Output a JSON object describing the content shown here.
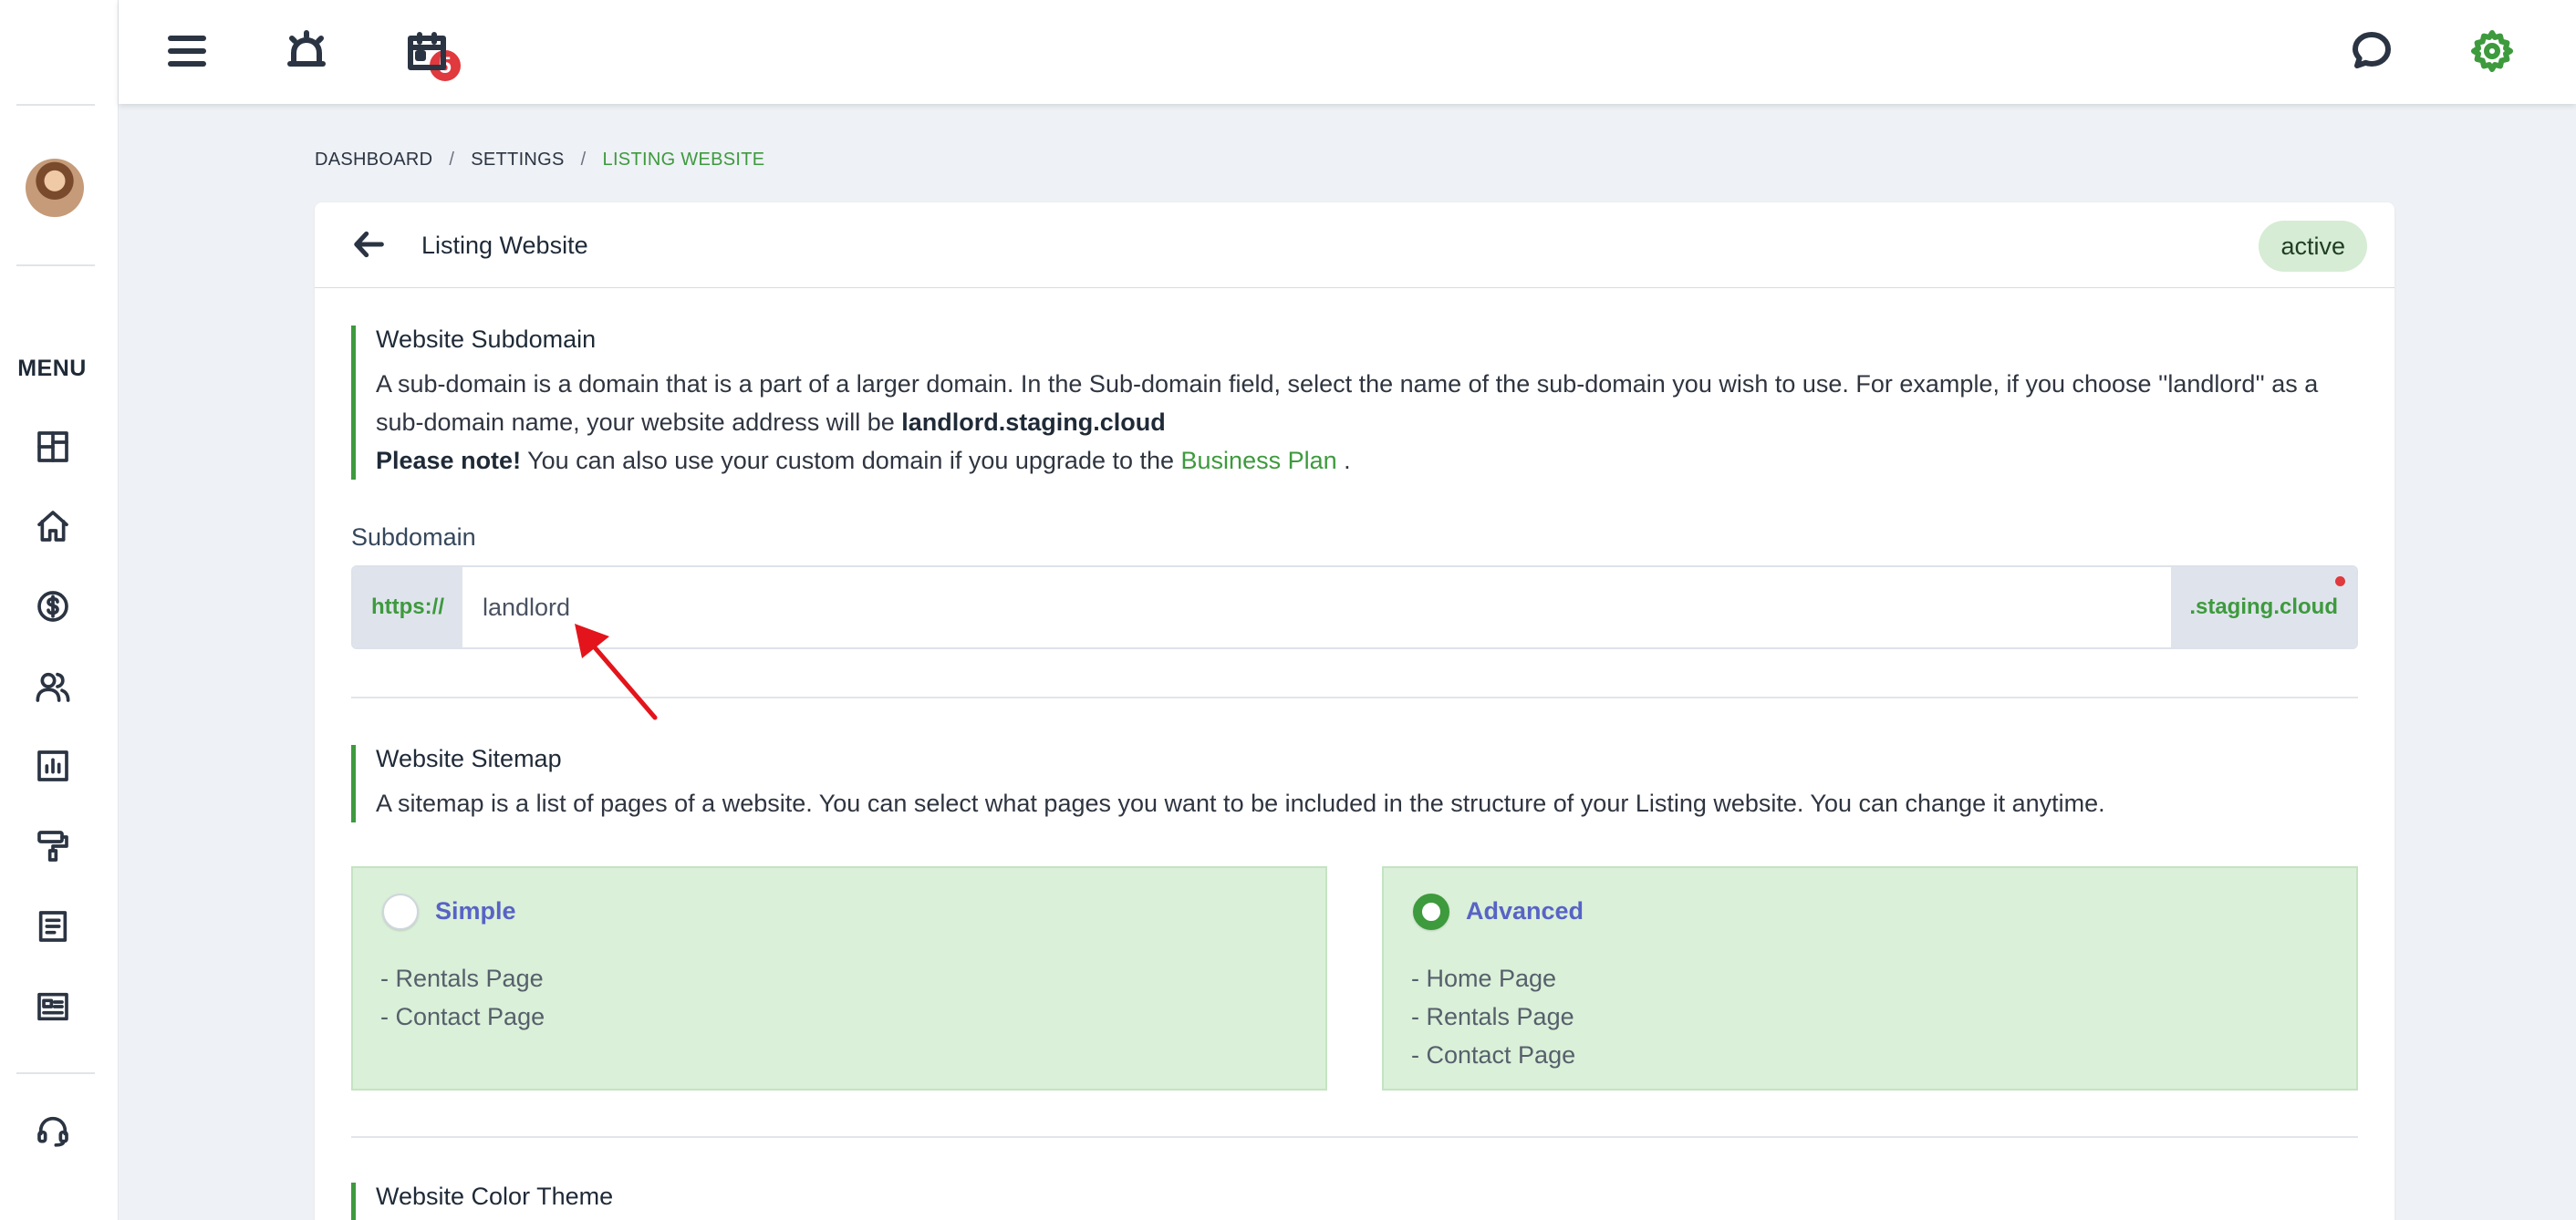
{
  "menu_label": "MENU",
  "notifications": {
    "count": "5"
  },
  "breadcrumb": {
    "items": [
      "DASHBOARD",
      "SETTINGS"
    ],
    "separator": "/",
    "current": "LISTING WEBSITE"
  },
  "header": {
    "title": "Listing Website",
    "status": "active"
  },
  "subdomain_section": {
    "title": "Website Subdomain",
    "desc_pre": "A sub-domain is a domain that is a part of a larger domain. In the Sub-domain field, select the name of the sub-domain you wish to use. For example, if you choose ''landlord'' as a sub-domain name, your website address will be ",
    "desc_bold": "landlord.staging.cloud",
    "note_bold": "Please note!",
    "note_text": " You can also use your custom domain if you upgrade to the ",
    "note_link": "Business Plan",
    "note_end": " ."
  },
  "subdomain_field": {
    "label": "Subdomain",
    "prefix": "https://",
    "value": "landlord",
    "suffix": ".staging.cloud"
  },
  "sitemap_section": {
    "title": "Website Sitemap",
    "desc": "A sitemap is a list of pages of a website. You can select what pages you want to be included in the structure of your Listing website. You can change it anytime."
  },
  "sitemap_options": {
    "simple": {
      "label": "Simple",
      "pages": [
        "- Rentals Page",
        "- Contact Page"
      ],
      "selected": false
    },
    "advanced": {
      "label": "Advanced",
      "pages": [
        "- Home Page",
        "- Rentals Page",
        "- Contact Page"
      ],
      "selected": true
    }
  },
  "color_section": {
    "title": "Website Color Theme"
  },
  "colors": {
    "accent": "#3d9a3d",
    "option_bg": "#daf0d8",
    "badge": "#e0393e",
    "option_title": "#5863c6"
  }
}
